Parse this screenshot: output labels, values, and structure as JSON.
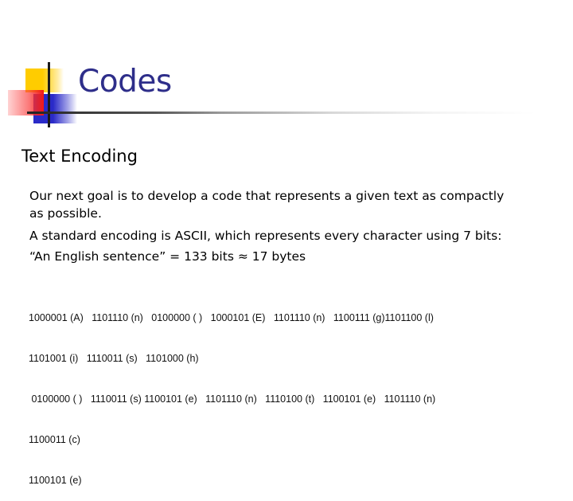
{
  "slide": {
    "title": "Codes",
    "subtitle": "Text Encoding",
    "paragraphs": [
      "Our next goal is to develop a code that represents a given text as compactly",
      "as possible.",
      "A standard encoding is ASCII, which represents every character using 7 bits:",
      "“An English sentence” = 133 bits ≈ 17 bytes"
    ],
    "code_lines": [
      "1000001 (A)   1101110 (n)   0100000 ( )   1000101 (E)   1101110 (n)   1100111 (g)1101100 (l)",
      "1101001 (i)   1110011 (s)   1101000 (h)",
      " 0100000 ( )   1110011 (s) 1100101 (e)   1101110 (n)   1110100 (t)   1100101 (e)   1101110 (n)",
      "1100011 (c)",
      "1100101 (e)"
    ]
  },
  "logo": {
    "colors": {
      "yellow": "#ffcc00",
      "blue": "#2a2ac8",
      "red": "#f01818",
      "title": "#2e2e8a"
    }
  }
}
